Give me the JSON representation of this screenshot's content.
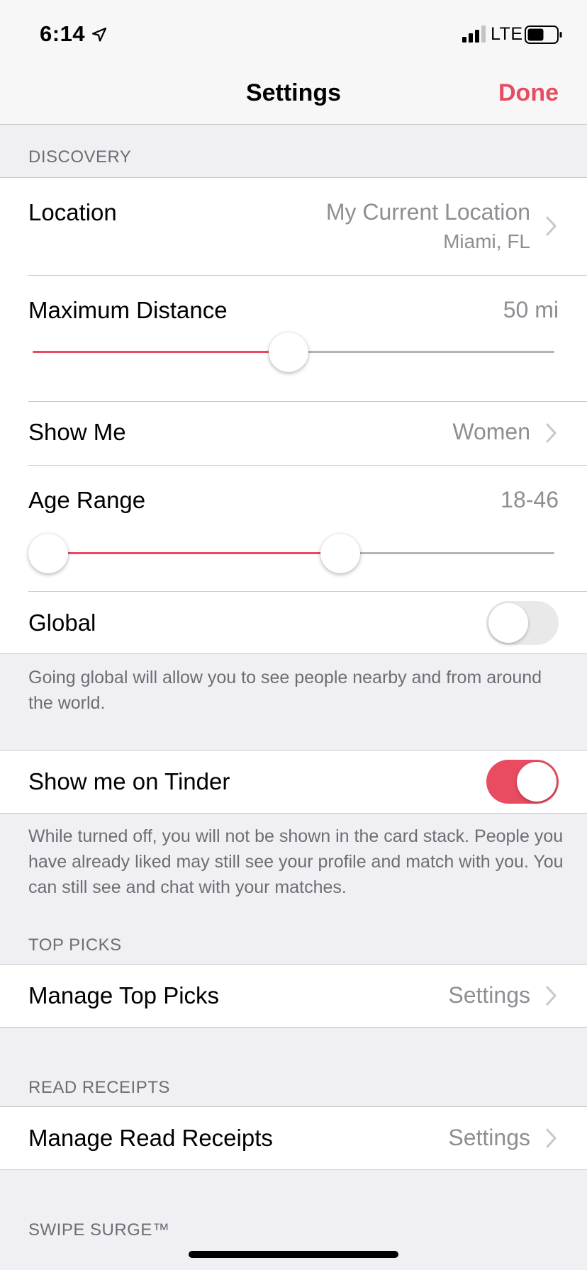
{
  "status_bar": {
    "time": "6:14",
    "carrier": "LTE",
    "icons": [
      "location-arrow-icon",
      "signal-icon",
      "battery-icon"
    ]
  },
  "nav": {
    "title": "Settings",
    "done_label": "Done"
  },
  "colors": {
    "accent": "#e94b61",
    "background": "#efeff4",
    "secondary_text": "#8e8e93"
  },
  "discovery": {
    "header": "DISCOVERY",
    "location": {
      "label": "Location",
      "value": "My Current Location",
      "subvalue": "Miami, FL"
    },
    "max_distance": {
      "label": "Maximum Distance",
      "value": "50 mi",
      "slider_fraction": 0.49
    },
    "show_me": {
      "label": "Show Me",
      "value": "Women"
    },
    "age_range": {
      "label": "Age Range",
      "value": "18-46",
      "low_fraction": 0.0,
      "high_fraction": 0.59
    },
    "global": {
      "label": "Global",
      "on": false,
      "footnote": "Going global will allow you to see people nearby and from around the world."
    }
  },
  "show_me_on_tinder": {
    "label": "Show me on Tinder",
    "on": true,
    "footnote": "While turned off, you will not be shown in the card stack. People you have already liked may still see your profile and match with you. You can still see and chat with your matches."
  },
  "top_picks": {
    "header": "TOP PICKS",
    "label": "Manage Top Picks",
    "value": "Settings"
  },
  "read_receipts": {
    "header": "READ RECEIPTS",
    "label": "Manage Read Receipts",
    "value": "Settings"
  },
  "swipe_surge": {
    "header": "SWIPE SURGE™"
  }
}
